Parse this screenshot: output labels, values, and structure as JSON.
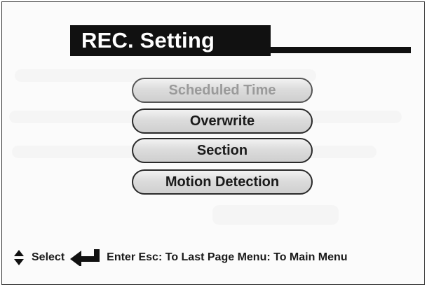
{
  "header": {
    "title": "REC. Setting"
  },
  "menu": {
    "items": [
      {
        "label": "Scheduled Time",
        "state": "disabled"
      },
      {
        "label": "Overwrite",
        "state": "enabled"
      },
      {
        "label": "Section",
        "state": "enabled"
      },
      {
        "label": "Motion Detection",
        "state": "enabled"
      }
    ]
  },
  "footer": {
    "select_label": "Select",
    "hints_label": "Enter Esc: To Last Page Menu: To Main Menu",
    "icons": {
      "navigate": "up-down-arrow-icon",
      "enter": "enter-arrow-icon"
    }
  },
  "colors": {
    "title_background": "#111111",
    "title_text": "#ffffff",
    "button_border": "#2a2a2a",
    "disabled_text": "#9a9a9a"
  }
}
